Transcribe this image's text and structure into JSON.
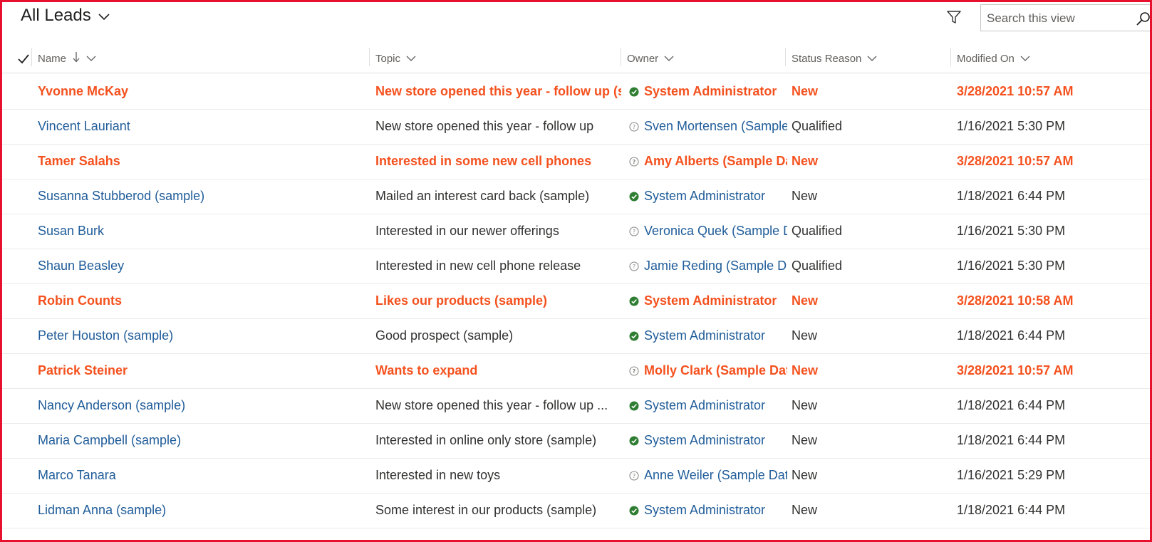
{
  "view": {
    "title": "All Leads",
    "search_placeholder": "Search this view"
  },
  "colors": {
    "highlight": "#f4511e",
    "link": "#1f5c99",
    "border_frame": "#e8112d",
    "status_ok": "#2e7d32"
  },
  "columns": {
    "name": "Name",
    "topic": "Topic",
    "owner": "Owner",
    "status": "Status Reason",
    "modified": "Modified On"
  },
  "rows": [
    {
      "name": "Yvonne McKay",
      "topic": "New store opened this year - follow up (sample)",
      "owner": "System Administrator",
      "owner_icon": "check-circle-icon",
      "status": "New",
      "modified": "3/28/2021 10:57 AM",
      "highlight": true
    },
    {
      "name": "Vincent Lauriant",
      "topic": "New store opened this year - follow up",
      "owner": "Sven Mortensen (Sample Data)",
      "owner_icon": "question-circle-icon",
      "status": "Qualified",
      "modified": "1/16/2021 5:30 PM",
      "highlight": false
    },
    {
      "name": "Tamer Salahs",
      "topic": "Interested in some new cell phones",
      "owner": "Amy Alberts (Sample Data)",
      "owner_icon": "question-circle-icon",
      "status": "New",
      "modified": "3/28/2021 10:57 AM",
      "highlight": true
    },
    {
      "name": "Susanna Stubberod (sample)",
      "topic": "Mailed an interest card back  (sample)",
      "owner": "System Administrator",
      "owner_icon": "check-circle-icon",
      "status": "New",
      "modified": "1/18/2021 6:44 PM",
      "highlight": false
    },
    {
      "name": "Susan Burk",
      "topic": "Interested in our newer offerings",
      "owner": "Veronica Quek (Sample Data)",
      "owner_icon": "question-circle-icon",
      "status": "Qualified",
      "modified": "1/16/2021 5:30 PM",
      "highlight": false
    },
    {
      "name": "Shaun Beasley",
      "topic": "Interested in new cell phone release",
      "owner": "Jamie Reding (Sample Data)",
      "owner_icon": "question-circle-icon",
      "status": "Qualified",
      "modified": "1/16/2021 5:30 PM",
      "highlight": false
    },
    {
      "name": "Robin Counts",
      "topic": "Likes our products (sample)",
      "owner": "System Administrator",
      "owner_icon": "check-circle-icon",
      "status": "New",
      "modified": "3/28/2021 10:58 AM",
      "highlight": true
    },
    {
      "name": "Peter Houston (sample)",
      "topic": "Good prospect (sample)",
      "owner": "System Administrator",
      "owner_icon": "check-circle-icon",
      "status": "New",
      "modified": "1/18/2021 6:44 PM",
      "highlight": false
    },
    {
      "name": "Patrick Steiner",
      "topic": "Wants to expand",
      "owner": "Molly Clark (Sample Data)",
      "owner_icon": "question-circle-icon",
      "status": "New",
      "modified": "3/28/2021 10:57 AM",
      "highlight": true
    },
    {
      "name": "Nancy Anderson (sample)",
      "topic": "New store opened this year - follow up ...",
      "owner": "System Administrator",
      "owner_icon": "check-circle-icon",
      "status": "New",
      "modified": "1/18/2021 6:44 PM",
      "highlight": false
    },
    {
      "name": "Maria Campbell (sample)",
      "topic": "Interested in online only store (sample)",
      "owner": "System Administrator",
      "owner_icon": "check-circle-icon",
      "status": "New",
      "modified": "1/18/2021 6:44 PM",
      "highlight": false
    },
    {
      "name": "Marco Tanara",
      "topic": "Interested in new toys",
      "owner": "Anne Weiler (Sample Data)",
      "owner_icon": "question-circle-icon",
      "status": "New",
      "modified": "1/16/2021 5:29 PM",
      "highlight": false
    },
    {
      "name": "Lidman Anna (sample)",
      "topic": "Some interest in our products (sample)",
      "owner": "System Administrator",
      "owner_icon": "check-circle-icon",
      "status": "New",
      "modified": "1/18/2021 6:44 PM",
      "highlight": false
    }
  ]
}
